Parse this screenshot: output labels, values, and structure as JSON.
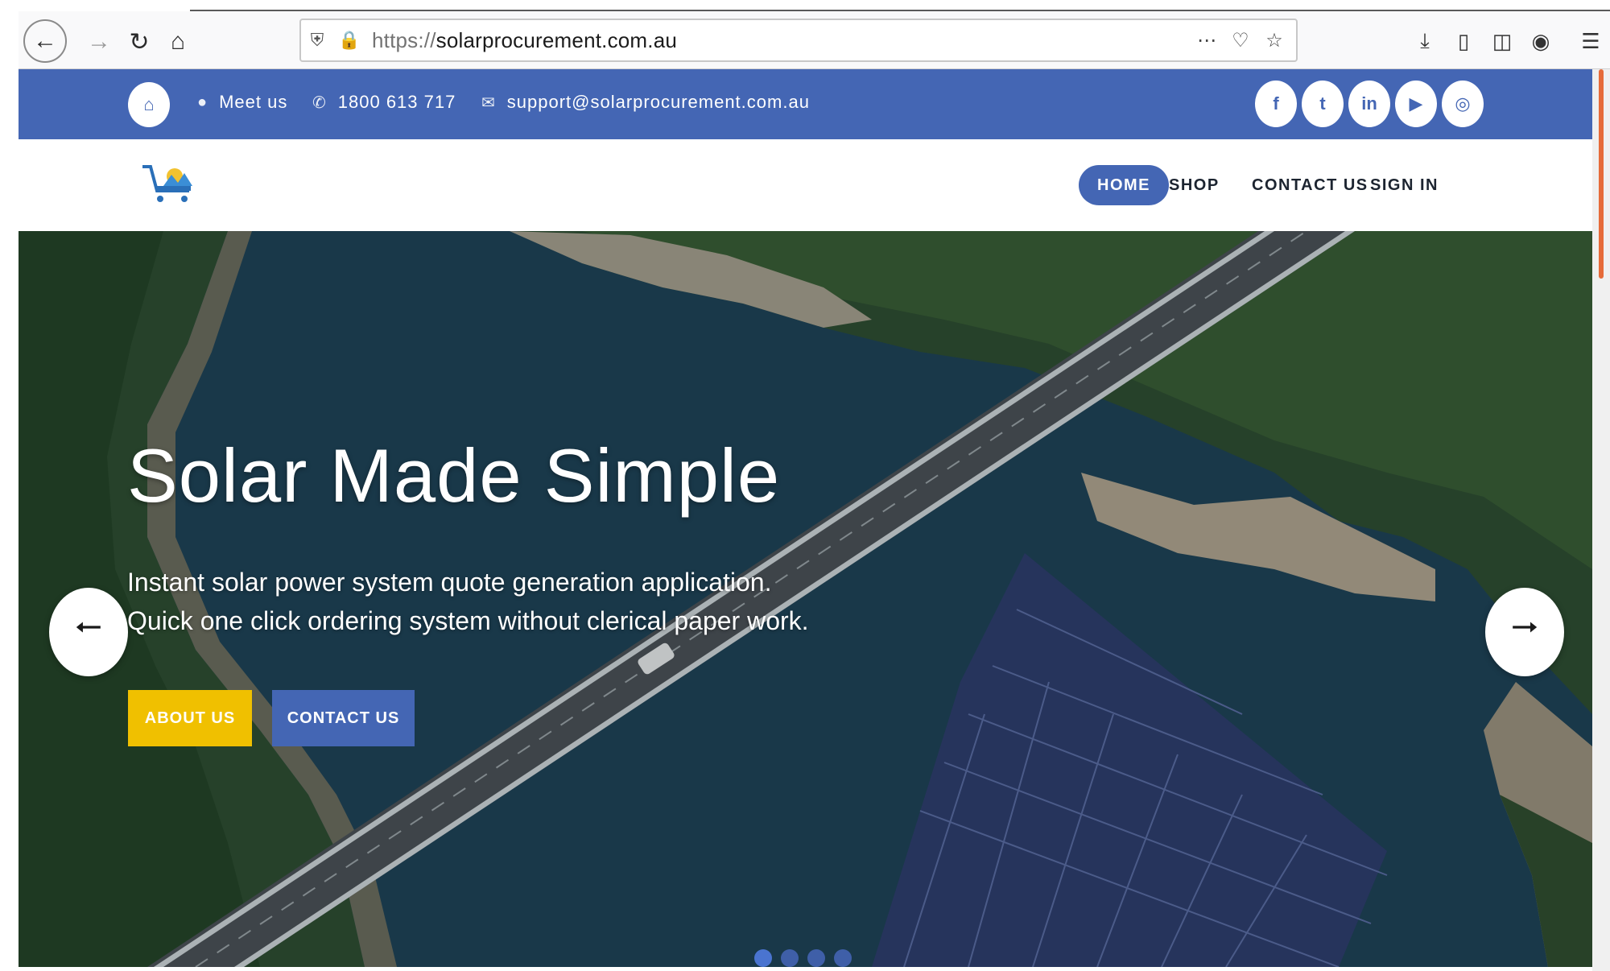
{
  "browser": {
    "url_protocol": "https://",
    "url_domain": "solarprocurement.com.au",
    "icons": {
      "back": "arrow-left-icon",
      "forward": "arrow-right-icon",
      "reload": "reload-icon",
      "home": "home-icon",
      "shield": "shield-icon",
      "lock": "lock-icon",
      "more": "more-dots-icon",
      "pocket": "pocket-icon",
      "bookmark": "star-icon",
      "download": "download-icon",
      "library": "library-icon",
      "sidebar": "sidebar-icon",
      "account": "account-icon",
      "menu": "hamburger-icon"
    }
  },
  "topbar": {
    "meet_us": "Meet us",
    "phone": "1800 613 717",
    "email": "support@solarprocurement.com.au",
    "social": [
      {
        "icon": "facebook-icon",
        "glyph": "f"
      },
      {
        "icon": "twitter-icon",
        "glyph": "t"
      },
      {
        "icon": "linkedin-icon",
        "glyph": "in"
      },
      {
        "icon": "youtube-icon",
        "glyph": "▶"
      },
      {
        "icon": "instagram-icon",
        "glyph": "◎"
      }
    ]
  },
  "nav": {
    "items": [
      {
        "label": "HOME",
        "active": true
      },
      {
        "label": "SHOP",
        "active": false
      },
      {
        "label": "CONTACT US",
        "active": false
      },
      {
        "label": "SIGN IN",
        "active": false
      }
    ]
  },
  "hero": {
    "title": "Solar Made Simple",
    "subtitle_line1": "Instant solar power system quote generation application.",
    "subtitle_line2": "Quick one click ordering system without clerical paper work.",
    "about_button": "ABOUT US",
    "contact_button": "CONTACT US",
    "slide_count": 4,
    "active_slide": 1
  },
  "colors": {
    "brand_blue": "#4466b4",
    "accent_yellow": "#f0c000",
    "water": "#1c3d4f"
  }
}
